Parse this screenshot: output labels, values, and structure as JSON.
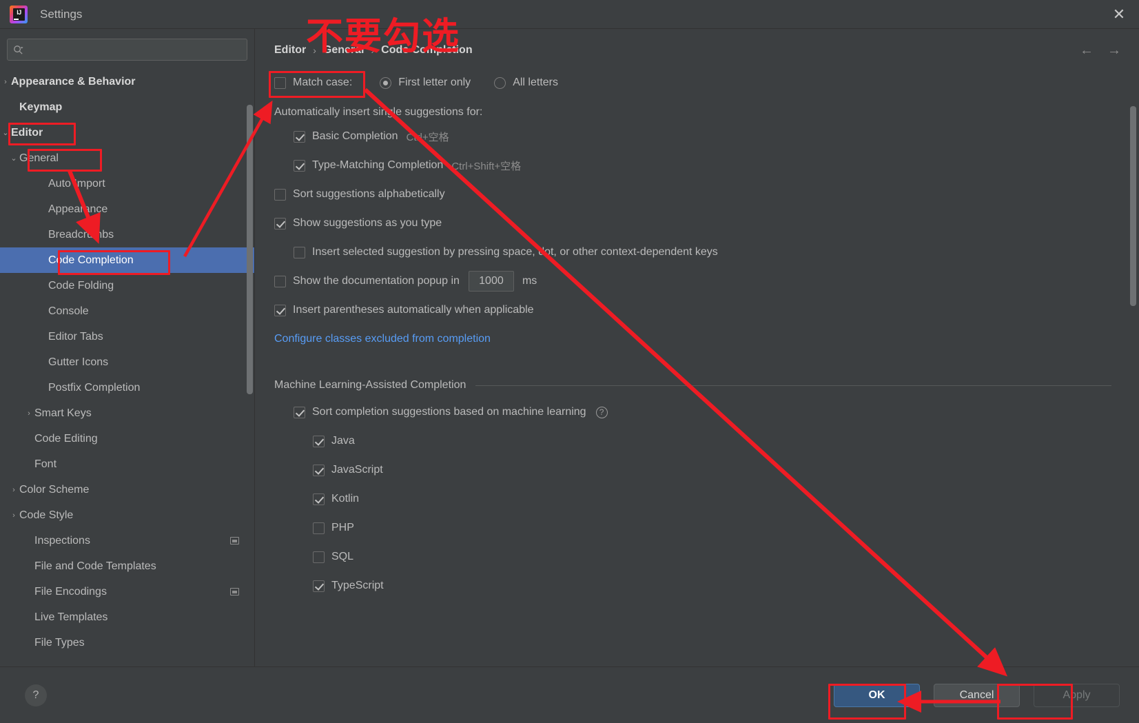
{
  "window": {
    "title": "Settings",
    "logo_text": "IJ",
    "close_label": "✕"
  },
  "search": {
    "value": "",
    "placeholder": ""
  },
  "sidebar": {
    "items": [
      {
        "label": "Appearance & Behavior",
        "arrow": "›",
        "indent": 0,
        "bold": true,
        "selected": false,
        "badge": false
      },
      {
        "label": "Keymap",
        "arrow": "",
        "indent": 1,
        "bold": true,
        "selected": false,
        "badge": false
      },
      {
        "label": "Editor",
        "arrow": "⌄",
        "indent": 0,
        "bold": true,
        "selected": false,
        "badge": false
      },
      {
        "label": "General",
        "arrow": "⌄",
        "indent": 1,
        "bold": false,
        "selected": false,
        "badge": false
      },
      {
        "label": "Auto Import",
        "arrow": "",
        "indent": 3,
        "bold": false,
        "selected": false,
        "badge": false
      },
      {
        "label": "Appearance",
        "arrow": "",
        "indent": 3,
        "bold": false,
        "selected": false,
        "badge": false
      },
      {
        "label": "Breadcrumbs",
        "arrow": "",
        "indent": 3,
        "bold": false,
        "selected": false,
        "badge": false
      },
      {
        "label": "Code Completion",
        "arrow": "",
        "indent": 3,
        "bold": false,
        "selected": true,
        "badge": false
      },
      {
        "label": "Code Folding",
        "arrow": "",
        "indent": 3,
        "bold": false,
        "selected": false,
        "badge": false
      },
      {
        "label": "Console",
        "arrow": "",
        "indent": 3,
        "bold": false,
        "selected": false,
        "badge": false
      },
      {
        "label": "Editor Tabs",
        "arrow": "",
        "indent": 3,
        "bold": false,
        "selected": false,
        "badge": false
      },
      {
        "label": "Gutter Icons",
        "arrow": "",
        "indent": 3,
        "bold": false,
        "selected": false,
        "badge": false
      },
      {
        "label": "Postfix Completion",
        "arrow": "",
        "indent": 3,
        "bold": false,
        "selected": false,
        "badge": false
      },
      {
        "label": "Smart Keys",
        "arrow": "›",
        "indent": 2,
        "bold": false,
        "selected": false,
        "badge": false
      },
      {
        "label": "Code Editing",
        "arrow": "",
        "indent": 2,
        "bold": false,
        "selected": false,
        "badge": false
      },
      {
        "label": "Font",
        "arrow": "",
        "indent": 2,
        "bold": false,
        "selected": false,
        "badge": false
      },
      {
        "label": "Color Scheme",
        "arrow": "›",
        "indent": 1,
        "bold": false,
        "selected": false,
        "badge": false
      },
      {
        "label": "Code Style",
        "arrow": "›",
        "indent": 1,
        "bold": false,
        "selected": false,
        "badge": false
      },
      {
        "label": "Inspections",
        "arrow": "",
        "indent": 2,
        "bold": false,
        "selected": false,
        "badge": true
      },
      {
        "label": "File and Code Templates",
        "arrow": "",
        "indent": 2,
        "bold": false,
        "selected": false,
        "badge": false
      },
      {
        "label": "File Encodings",
        "arrow": "",
        "indent": 2,
        "bold": false,
        "selected": false,
        "badge": true
      },
      {
        "label": "Live Templates",
        "arrow": "",
        "indent": 2,
        "bold": false,
        "selected": false,
        "badge": false
      },
      {
        "label": "File Types",
        "arrow": "",
        "indent": 2,
        "bold": false,
        "selected": false,
        "badge": false
      }
    ]
  },
  "breadcrumb": {
    "part1": "Editor",
    "part2": "General",
    "part3": "Code Completion",
    "sep": "›",
    "back_arrow": "←",
    "forward_arrow": "→"
  },
  "main": {
    "match_case": {
      "label": "Match case:",
      "checked": false,
      "options": [
        {
          "label": "First letter only",
          "selected": true
        },
        {
          "label": "All letters",
          "selected": false
        }
      ]
    },
    "auto_insert_header": "Automatically insert single suggestions for:",
    "auto_insert_items": [
      {
        "label": "Basic Completion",
        "shortcut": "Ctrl+空格",
        "checked": true
      },
      {
        "label": "Type-Matching Completion",
        "shortcut": "Ctrl+Shift+空格",
        "checked": true
      }
    ],
    "sort_alpha": {
      "label": "Sort suggestions alphabetically",
      "checked": false
    },
    "show_as_type": {
      "label": "Show suggestions as you type",
      "checked": true
    },
    "insert_selected": {
      "label": "Insert selected suggestion by pressing space, dot, or other context-dependent keys",
      "checked": false
    },
    "doc_popup": {
      "label": "Show the documentation popup in",
      "checked": false,
      "value": "1000",
      "unit": "ms"
    },
    "insert_parens": {
      "label": "Insert parentheses automatically when applicable",
      "checked": true
    },
    "configure_link": "Configure classes excluded from completion",
    "ml_section_title": "Machine Learning-Assisted Completion",
    "ml_sort": {
      "label": "Sort completion suggestions based on machine learning",
      "checked": true,
      "help": "?"
    },
    "ml_languages": [
      {
        "label": "Java",
        "checked": true
      },
      {
        "label": "JavaScript",
        "checked": true
      },
      {
        "label": "Kotlin",
        "checked": true
      },
      {
        "label": "PHP",
        "checked": false
      },
      {
        "label": "SQL",
        "checked": false
      },
      {
        "label": "TypeScript",
        "checked": true
      }
    ]
  },
  "footer": {
    "help": "?",
    "ok": "OK",
    "cancel": "Cancel",
    "apply": "Apply"
  },
  "annotations": {
    "chinese_note": "不要勾选",
    "accent_color": "#ee1c24"
  }
}
